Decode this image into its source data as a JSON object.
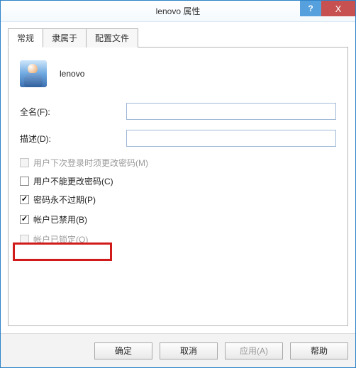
{
  "titlebar": {
    "title": "lenovo 属性",
    "help_symbol": "?",
    "close_symbol": "X"
  },
  "tabs": [
    {
      "label": "常规",
      "active": true
    },
    {
      "label": "隶属于",
      "active": false
    },
    {
      "label": "配置文件",
      "active": false
    }
  ],
  "user": {
    "name": "lenovo"
  },
  "fields": {
    "fullname_label": "全名(F):",
    "fullname_value": "",
    "description_label": "描述(D):",
    "description_value": ""
  },
  "checks": {
    "must_change_label": "用户下次登录时须更改密码(M)",
    "cannot_change_label": "用户不能更改密码(C)",
    "never_expires_label": "密码永不过期(P)",
    "disabled_label": "帐户已禁用(B)",
    "locked_label": "帐户已锁定(O)"
  },
  "buttons": {
    "ok": "确定",
    "cancel": "取消",
    "apply": "应用(A)",
    "help": "帮助"
  }
}
